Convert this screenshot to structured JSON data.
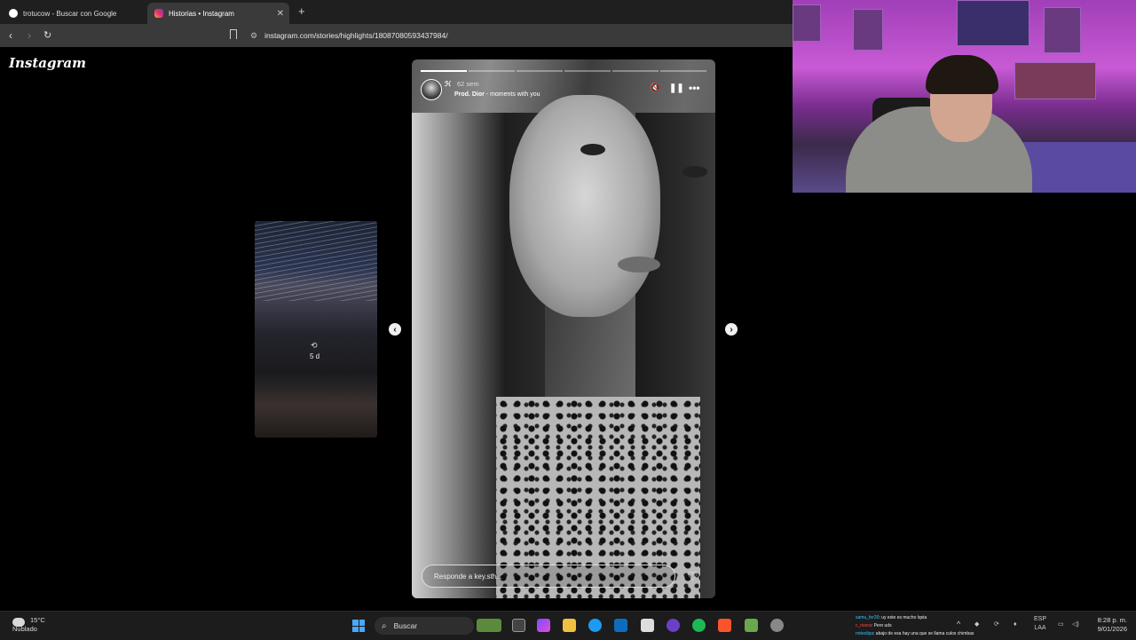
{
  "browser": {
    "tabs": [
      {
        "label": "trotucow - Buscar con Google",
        "active": false
      },
      {
        "label": "Historias • Instagram",
        "active": true
      }
    ],
    "url": "instagram.com/stories/highlights/18087080593437984/"
  },
  "page": {
    "logo": "Instagram",
    "previous_story": {
      "time": "5 d"
    },
    "story": {
      "username": "ℋ",
      "time": "62 sem",
      "music_artist": "Prod. Dior",
      "music_title": " - moments with you",
      "reply_placeholder": "Responde a key.sth...",
      "progress_total": 6,
      "progress_done": 1
    }
  },
  "taskbar": {
    "weather_temp": "15°C",
    "weather_desc": "Nublado",
    "search_label": "Buscar",
    "lang_top": "ESP",
    "lang_bottom": "LAA",
    "time": "8:28 p. m.",
    "date": "9/01/2026",
    "chat": [
      {
        "user": "samu_fer20",
        "msg": ": uy este es mucho lqsta",
        "color": "#35c4ff"
      },
      {
        "user": "c_rivera",
        "msg": ": Pero uds",
        "color": "#ff4a4a"
      },
      {
        "user": "notecilpa",
        "msg": ": abajo de esa hay una que se llama culos chimbas",
        "color": "#35c4ff"
      }
    ]
  },
  "colors": {
    "accent": "#4aa7ff",
    "background": "#000000"
  }
}
